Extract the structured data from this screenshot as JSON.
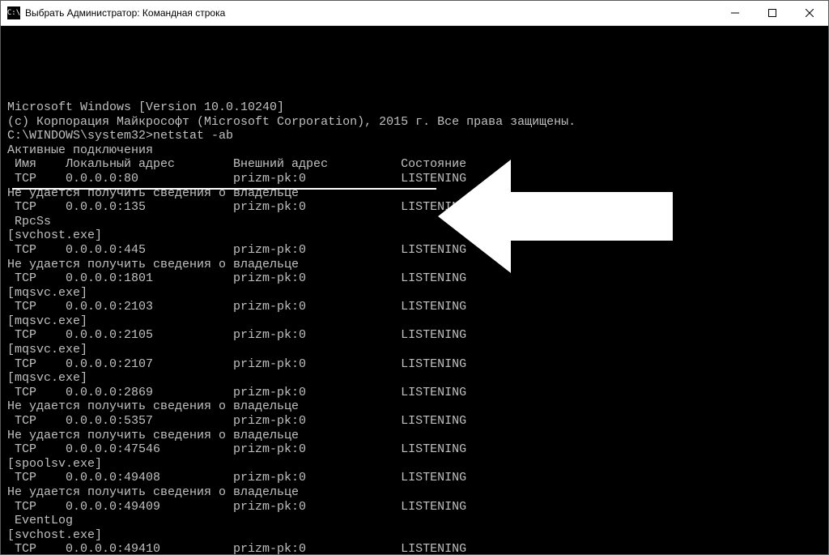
{
  "window": {
    "title": "Выбрать Администратор: Командная строка",
    "icon_label": "C:\\"
  },
  "console": {
    "banner1": "Microsoft Windows [Version 10.0.10240]",
    "banner2": "(c) Корпорация Майкрософт (Microsoft Corporation), 2015 г. Все права защищены.",
    "prompt": "C:\\WINDOWS\\system32>",
    "command": "netstat -ab",
    "section_title": "Активные подключения",
    "columns": {
      "proto": "Имя",
      "local": "Локальный адрес",
      "remote": "Внешний адрес",
      "state": "Состояние"
    },
    "owner_fail": "Не удается получить сведения о владельце",
    "lines": [
      {
        "type": "conn",
        "proto": "TCP",
        "local": "0.0.0.0:80",
        "remote": "prizm-pk:0",
        "state": "LISTENING"
      },
      {
        "type": "msg",
        "text_key": "owner_fail"
      },
      {
        "type": "conn",
        "proto": "TCP",
        "local": "0.0.0.0:135",
        "remote": "prizm-pk:0",
        "state": "LISTENING"
      },
      {
        "type": "proc",
        "text": " RpcSs"
      },
      {
        "type": "proc",
        "text": "[svchost.exe]"
      },
      {
        "type": "conn",
        "proto": "TCP",
        "local": "0.0.0.0:445",
        "remote": "prizm-pk:0",
        "state": "LISTENING"
      },
      {
        "type": "msg",
        "text_key": "owner_fail"
      },
      {
        "type": "conn",
        "proto": "TCP",
        "local": "0.0.0.0:1801",
        "remote": "prizm-pk:0",
        "state": "LISTENING"
      },
      {
        "type": "proc",
        "text": "[mqsvc.exe]"
      },
      {
        "type": "conn",
        "proto": "TCP",
        "local": "0.0.0.0:2103",
        "remote": "prizm-pk:0",
        "state": "LISTENING"
      },
      {
        "type": "proc",
        "text": "[mqsvc.exe]"
      },
      {
        "type": "conn",
        "proto": "TCP",
        "local": "0.0.0.0:2105",
        "remote": "prizm-pk:0",
        "state": "LISTENING"
      },
      {
        "type": "proc",
        "text": "[mqsvc.exe]"
      },
      {
        "type": "conn",
        "proto": "TCP",
        "local": "0.0.0.0:2107",
        "remote": "prizm-pk:0",
        "state": "LISTENING"
      },
      {
        "type": "proc",
        "text": "[mqsvc.exe]"
      },
      {
        "type": "conn",
        "proto": "TCP",
        "local": "0.0.0.0:2869",
        "remote": "prizm-pk:0",
        "state": "LISTENING"
      },
      {
        "type": "msg",
        "text_key": "owner_fail"
      },
      {
        "type": "conn",
        "proto": "TCP",
        "local": "0.0.0.0:5357",
        "remote": "prizm-pk:0",
        "state": "LISTENING"
      },
      {
        "type": "msg",
        "text_key": "owner_fail"
      },
      {
        "type": "conn",
        "proto": "TCP",
        "local": "0.0.0.0:47546",
        "remote": "prizm-pk:0",
        "state": "LISTENING"
      },
      {
        "type": "proc",
        "text": "[spoolsv.exe]"
      },
      {
        "type": "conn",
        "proto": "TCP",
        "local": "0.0.0.0:49408",
        "remote": "prizm-pk:0",
        "state": "LISTENING"
      },
      {
        "type": "msg",
        "text_key": "owner_fail"
      },
      {
        "type": "conn",
        "proto": "TCP",
        "local": "0.0.0.0:49409",
        "remote": "prizm-pk:0",
        "state": "LISTENING"
      },
      {
        "type": "proc",
        "text": " EventLog"
      },
      {
        "type": "proc",
        "text": "[svchost.exe]"
      },
      {
        "type": "conn",
        "proto": "TCP",
        "local": "0.0.0.0:49410",
        "remote": "prizm-pk:0",
        "state": "LISTENING"
      }
    ]
  }
}
